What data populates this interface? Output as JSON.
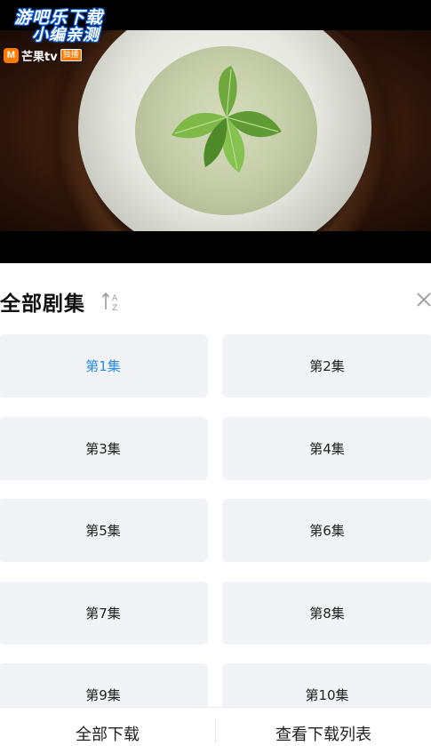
{
  "video": {
    "watermark_line1": "游吧乐下载",
    "watermark_line2": "小编亲测",
    "channel_logo_letter": "M",
    "channel_name": "芒果tv",
    "channel_tag": "独播"
  },
  "episodes_panel": {
    "title": "全部剧集",
    "sort_icon": "sort-az-icon",
    "close_icon": "close-icon",
    "episodes": [
      {
        "label": "第1集",
        "selected": true
      },
      {
        "label": "第2集",
        "selected": false
      },
      {
        "label": "第3集",
        "selected": false
      },
      {
        "label": "第4集",
        "selected": false
      },
      {
        "label": "第5集",
        "selected": false
      },
      {
        "label": "第6集",
        "selected": false
      },
      {
        "label": "第7集",
        "selected": false
      },
      {
        "label": "第8集",
        "selected": false
      },
      {
        "label": "第9集",
        "selected": false
      },
      {
        "label": "第10集",
        "selected": false
      }
    ]
  },
  "bottom_bar": {
    "download_all": "全部下载",
    "view_download_list": "查看下载列表"
  },
  "colors": {
    "selected_text": "#2a8be8",
    "tile_background": "#f1f3f7",
    "brand_orange": "#ff7a00"
  }
}
